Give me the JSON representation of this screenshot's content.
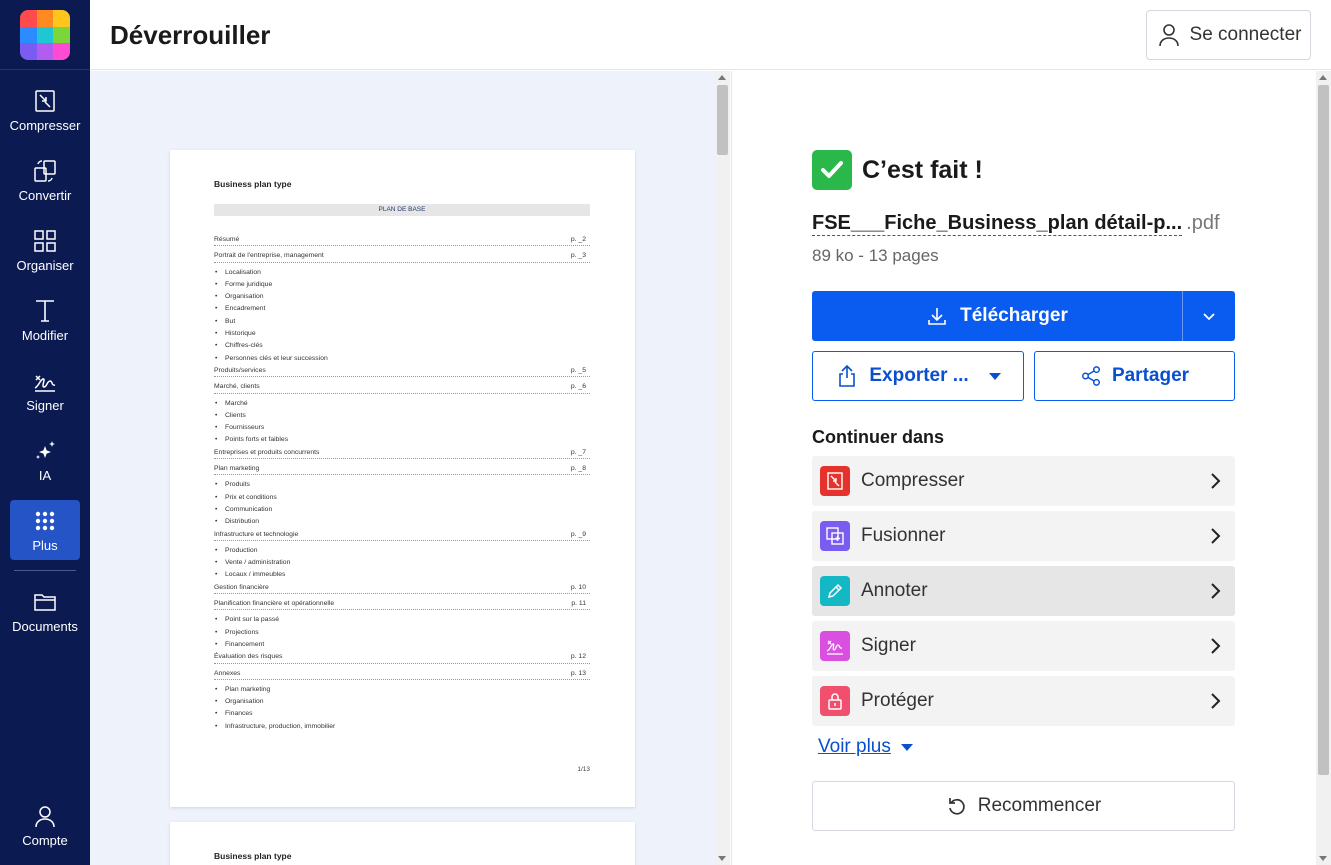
{
  "header": {
    "title": "Déverrouiller",
    "login_label": "Se connecter"
  },
  "sidebar": {
    "items": [
      {
        "label": "Compresser",
        "icon": "compress-icon"
      },
      {
        "label": "Convertir",
        "icon": "convert-icon"
      },
      {
        "label": "Organiser",
        "icon": "organize-icon"
      },
      {
        "label": "Modifier",
        "icon": "text-edit-icon"
      },
      {
        "label": "Signer",
        "icon": "signature-icon"
      },
      {
        "label": "IA",
        "icon": "sparkle-icon"
      },
      {
        "label": "Plus",
        "icon": "grid-dots-icon",
        "active": true
      },
      {
        "label": "Documents",
        "icon": "folder-icon"
      }
    ],
    "account_label": "Compte"
  },
  "preview": {
    "page1": {
      "title": "Business plan type",
      "band": "PLAN DE BASE",
      "toc": [
        {
          "t": "sec",
          "text": "Résumé",
          "page": "p. _2"
        },
        {
          "t": "sec",
          "text": "Portrait de l'entreprise, management",
          "page": "p. _3"
        },
        {
          "t": "bul",
          "text": "Localisation"
        },
        {
          "t": "bul",
          "text": "Forme juridique"
        },
        {
          "t": "bul",
          "text": "Organisation"
        },
        {
          "t": "bul",
          "text": "Encadrement"
        },
        {
          "t": "bul",
          "text": "But"
        },
        {
          "t": "bul",
          "text": "Historique"
        },
        {
          "t": "bul",
          "text": "Chiffres-clés"
        },
        {
          "t": "bul",
          "text": "Personnes clés et leur succession"
        },
        {
          "t": "sec",
          "text": "Produits/services",
          "page": "p. _5"
        },
        {
          "t": "sec",
          "text": "Marché, clients",
          "page": "p. _6"
        },
        {
          "t": "bul",
          "text": "Marché"
        },
        {
          "t": "bul",
          "text": "Clients"
        },
        {
          "t": "bul",
          "text": "Fournisseurs"
        },
        {
          "t": "bul",
          "text": "Points forts et faibles"
        },
        {
          "t": "sec",
          "text": "Entreprises et produits concurrents",
          "page": "p. _7"
        },
        {
          "t": "sec",
          "text": "Plan marketing",
          "page": "p. _8"
        },
        {
          "t": "bul",
          "text": "Produits"
        },
        {
          "t": "bul",
          "text": "Prix et conditions"
        },
        {
          "t": "bul",
          "text": "Communication"
        },
        {
          "t": "bul",
          "text": "Distribution"
        },
        {
          "t": "sec",
          "text": "Infrastructure et technologie",
          "page": "p. _9"
        },
        {
          "t": "bul",
          "text": "Production"
        },
        {
          "t": "bul",
          "text": "Vente / administration"
        },
        {
          "t": "bul",
          "text": "Locaux / immeubles"
        },
        {
          "t": "sec",
          "text": "Gestion financière",
          "page": "p. 10"
        },
        {
          "t": "sec",
          "text": "Planification financière et opérationnelle",
          "page": "p. 11"
        },
        {
          "t": "bul",
          "text": "Point sur la passé"
        },
        {
          "t": "bul",
          "text": "Projections"
        },
        {
          "t": "bul",
          "text": "Financement"
        },
        {
          "t": "sec",
          "text": "Évaluation des risques",
          "page": "p. 12"
        },
        {
          "t": "sec",
          "text": "Annexes",
          "page": "p. 13"
        },
        {
          "t": "bul",
          "text": "Plan marketing"
        },
        {
          "t": "bul",
          "text": "Organisation"
        },
        {
          "t": "bul",
          "text": "Finances"
        },
        {
          "t": "bul",
          "text": "Infrastructure, production, immobilier"
        }
      ],
      "page_number": "1/13"
    },
    "page2": {
      "title": "Business plan type"
    }
  },
  "result": {
    "status": "C’est fait !",
    "file_name": "FSE___Fiche_Business_plan détail-p...",
    "file_ext": ".pdf",
    "file_info": "89 ko - 13 pages",
    "download_label": "Télécharger",
    "export_label": "Exporter ...",
    "share_label": "Partager",
    "continue_title": "Continuer dans",
    "tools": [
      {
        "label": "Compresser",
        "icon": "compress-icon",
        "color": "#e5322d"
      },
      {
        "label": "Fusionner",
        "icon": "merge-icon",
        "color": "#7a5cf0"
      },
      {
        "label": "Annoter",
        "icon": "pencil-icon",
        "color": "#14b8c4"
      },
      {
        "label": "Signer",
        "icon": "signature-icon",
        "color": "#d94fe0"
      },
      {
        "label": "Protéger",
        "icon": "lock-icon",
        "color": "#f0506e"
      }
    ],
    "see_more": "Voir plus",
    "restart_label": "Recommencer"
  },
  "colors": {
    "sidebar_bg": "#0b1b52",
    "accent": "#0a5cf0",
    "success": "#2ab84a"
  }
}
